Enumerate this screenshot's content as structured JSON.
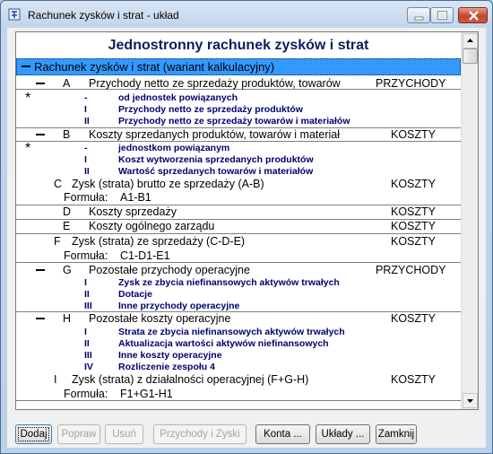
{
  "window": {
    "title": "Rachunek zysków i strat - układ"
  },
  "report": {
    "header": "Jednostronny rachunek zysków i strat",
    "section_label": "Rachunek zysków i strat (wariant kalkulacyjny)"
  },
  "rows": {
    "A": {
      "letter": "A",
      "label": "Przychody netto ze sprzedaży produktów, towarów",
      "type": "PRZYCHODY"
    },
    "A0": {
      "num": "-",
      "label": "od jednostek powiązanych"
    },
    "A1": {
      "num": "I",
      "label": "Przychody netto ze sprzedaży produktów"
    },
    "A2": {
      "num": "II",
      "label": "Przychody netto ze sprzedaży towarów i materiałów"
    },
    "B": {
      "letter": "B",
      "label": "Koszty sprzedanych produktów, towarów i materiał",
      "type": "KOSZTY"
    },
    "B0": {
      "num": "-",
      "label": "jednostkom powiązanym"
    },
    "B1": {
      "num": "I",
      "label": "Koszt wytworzenia sprzedanych produktów"
    },
    "B2": {
      "num": "II",
      "label": "Wartość sprzedanych towarów i materiałów"
    },
    "C": {
      "letter": "C",
      "label": "Zysk (strata) brutto ze sprzedaży (A-B)",
      "type": "KOSZTY",
      "formula_label": "Formuła:",
      "formula": "A1-B1"
    },
    "D": {
      "letter": "D",
      "label": "Koszty sprzedaży",
      "type": "KOSZTY"
    },
    "E": {
      "letter": "E",
      "label": "Koszty ogólnego zarządu",
      "type": "KOSZTY"
    },
    "F": {
      "letter": "F",
      "label": "Zysk (strata) ze sprzedaży (C-D-E)",
      "type": "KOSZTY",
      "formula_label": "Formuła:",
      "formula": "C1-D1-E1"
    },
    "G": {
      "letter": "G",
      "label": "Pozostałe przychody operacyjne",
      "type": "PRZYCHODY"
    },
    "G1": {
      "num": "I",
      "label": "Zysk ze zbycia niefinansowych aktywów trwałych"
    },
    "G2": {
      "num": "II",
      "label": "Dotacje"
    },
    "G3": {
      "num": "III",
      "label": "Inne przychody operacyjne"
    },
    "H": {
      "letter": "H",
      "label": "Pozostałe koszty operacyjne",
      "type": "KOSZTY"
    },
    "H1": {
      "num": "I",
      "label": "Strata ze zbycia niefinansowych aktywów trwałych"
    },
    "H2": {
      "num": "II",
      "label": "Aktualizacja wartości aktywów niefinansowych"
    },
    "H3": {
      "num": "III",
      "label": "Inne koszty operacyjne"
    },
    "H4": {
      "num": "IV",
      "label": "Rozliczenie zespołu 4"
    },
    "I": {
      "letter": "I",
      "label": "Zysk (strata) z działalności operacyjnej (F+G-H)",
      "type": "KOSZTY",
      "formula_label": "Formuła:",
      "formula": "F1+G1-H1"
    }
  },
  "buttons": {
    "dodaj": "Dodaj",
    "popraw": "Popraw",
    "usun": "Usuń",
    "przychody": "Przychody i Zyski",
    "konta": "Konta ...",
    "uklady": "Układy ...",
    "zamknij": "Zamknij"
  },
  "colors": {
    "section_bg": "#3399ff",
    "sub_text": "#00006e",
    "header_text": "#0b1f5c"
  }
}
